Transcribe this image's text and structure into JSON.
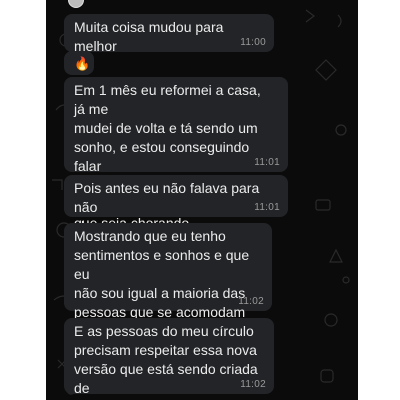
{
  "chat": {
    "messages": [
      {
        "text": "Muita coisa mudou para melhor",
        "time": "11:00"
      },
      {
        "text": "🔥",
        "time": ""
      },
      {
        "text": "Em 1 mês eu reformei a casa, já me\nmudei de volta e tá sendo um\nsonho, e estou conseguindo falar\ntudo oq eu sinto e penso mesmo\nque seja chorando",
        "time": "11:01"
      },
      {
        "text": "Pois antes eu não falava para não\nchorar",
        "time": "11:01"
      },
      {
        "text": "Mostrando que eu tenho\nsentimentos e sonhos e que eu\nnão sou igual a maioria das\npessoas que se acomodam",
        "time": "11:02"
      },
      {
        "text": "E as pessoas do meu círculo\nprecisam respeitar essa nova\nversão que está sendo criada de\nmim",
        "time": "11:02"
      }
    ]
  },
  "colors": {
    "background": "#0b0b0b",
    "bubble": "#222427",
    "text": "#ececec",
    "timestamp": "#9a9a9a"
  },
  "icons": {
    "wallpaper": "doodle-pattern",
    "avatar": "contact-avatar"
  }
}
